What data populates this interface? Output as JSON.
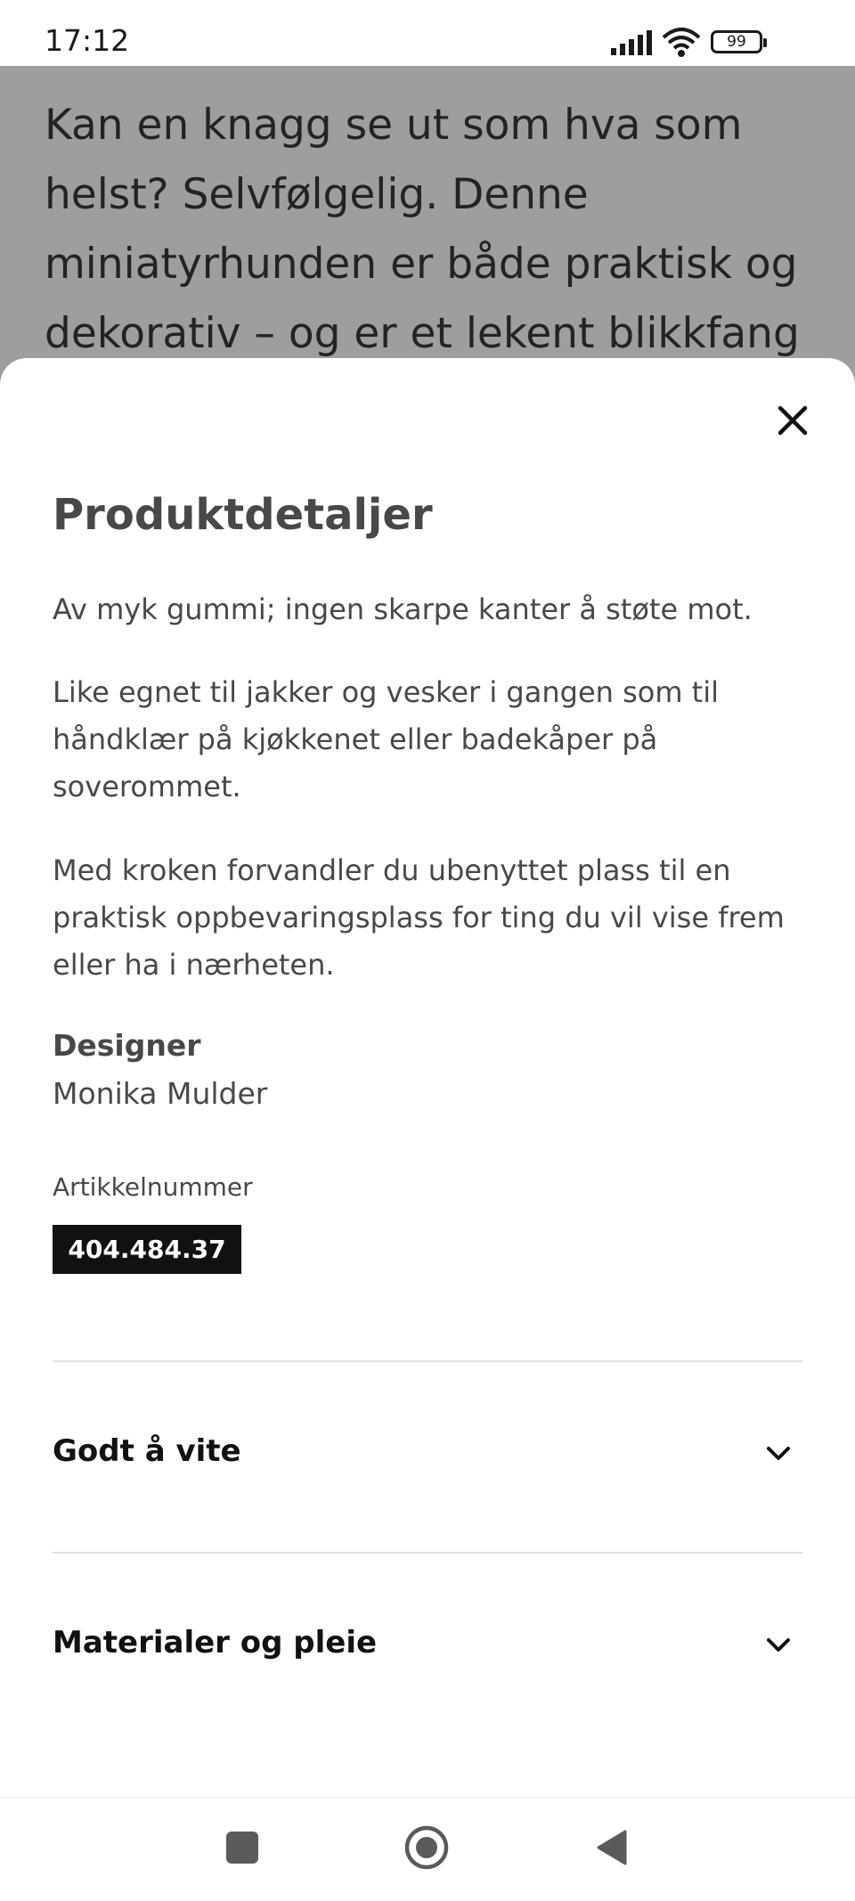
{
  "status_bar": {
    "time": "17:12",
    "battery": "99",
    "icons": [
      "signal-icon",
      "wifi-icon",
      "battery-icon"
    ]
  },
  "background_page": {
    "description_text": "Kan en knagg se ut som hva som helst? Selvfølgelig. Denne miniatyrhunden er både praktisk og dekorativ – og er et lekent blikkfang"
  },
  "sheet": {
    "close_icon": "close-icon",
    "title": "Produktdetaljer",
    "paragraphs": [
      "Av myk gummi; ingen skarpe kanter å støte mot.",
      "Like egnet til jakker og vesker i gangen som til håndklær på kjøkkenet eller badekåper på soverommet.",
      "Med kroken forvandler du ubenyttet plass til en praktisk oppbevaringsplass for ting du vil vise frem eller ha i nærheten."
    ],
    "designer_label": "Designer",
    "designer_name": "Monika Mulder",
    "article_label": "Artikkelnummer",
    "article_number": "404.484.37",
    "accordions": [
      {
        "label": "Godt å vite",
        "icon": "chevron-down-icon"
      },
      {
        "label": "Materialer og pleie",
        "icon": "chevron-down-icon"
      }
    ]
  },
  "navbar": {
    "icons": [
      "recent-apps-icon",
      "home-icon",
      "back-icon"
    ]
  },
  "colors": {
    "text": "#484848",
    "overlay": "#9e9e9e",
    "badge_bg": "#111111"
  }
}
